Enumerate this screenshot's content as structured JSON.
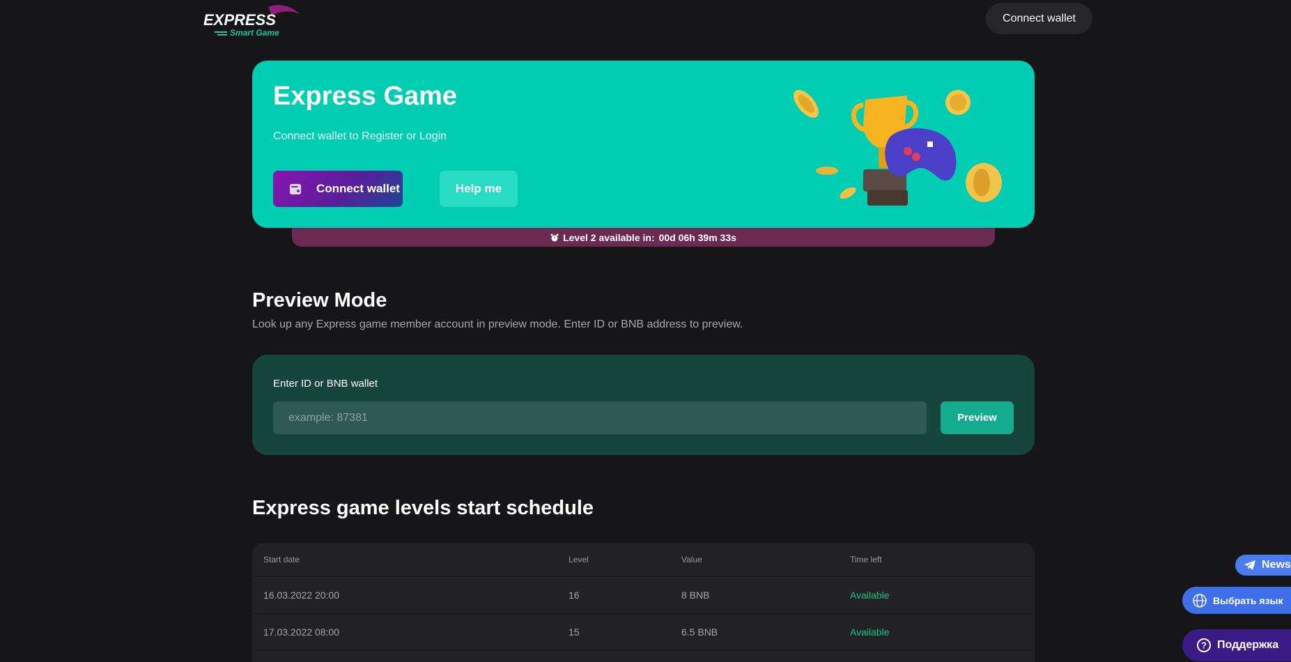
{
  "header": {
    "logo_word": "EXPRESS",
    "logo_sub": "Smart Game",
    "connect_label": "Connect wallet"
  },
  "hero": {
    "title": "Express Game",
    "subtitle": "Connect wallet to Register or Login",
    "connect_label": "Connect wallet",
    "help_label": "Help me",
    "level_prefix": "Level 2 available in:",
    "level_timer": "00d 06h 39m 33s"
  },
  "preview": {
    "title": "Preview Mode",
    "description": "Look up any Express game member account in preview mode. Enter ID or BNB address to preview.",
    "field_label": "Enter ID or BNB wallet",
    "placeholder": "example: 87381",
    "button_label": "Preview"
  },
  "schedule": {
    "title": "Express game levels start schedule",
    "headers": [
      "Start date",
      "Level",
      "Value",
      "Time left"
    ],
    "rows": [
      [
        "16.03.2022 20:00",
        "16",
        "8 BNB",
        "Available"
      ],
      [
        "17.03.2022 08:00",
        "15",
        "6.5 BNB",
        "Available"
      ]
    ]
  },
  "floating": {
    "news_label": "News",
    "language_label": "Выбрать язык",
    "support_label": "Поддержка"
  },
  "colors": {
    "background": "#161618",
    "hero": "#00cdb2",
    "preview_card": "#17453c",
    "available": "#17c48f"
  }
}
